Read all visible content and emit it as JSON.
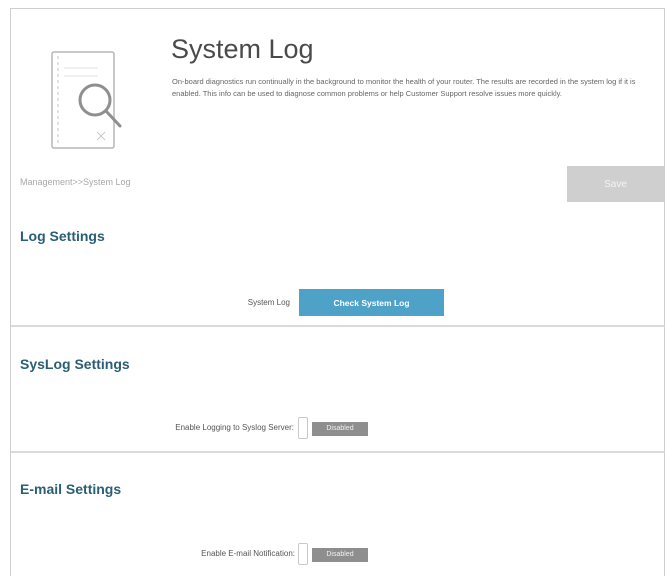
{
  "header": {
    "title": "System Log",
    "description": "On-board diagnostics run continually in the background to monitor the health of your router. The results are recorded in the system log if it is enabled. This info can be used to diagnose common problems or help Customer Support resolve issues more quickly."
  },
  "breadcrumb": "Management>>System Log",
  "save_label": "Save",
  "log_settings": {
    "title": "Log Settings",
    "system_log_label": "System Log",
    "check_button": "Check System Log"
  },
  "syslog_settings": {
    "title": "SysLog Settings",
    "enable_label": "Enable Logging to Syslog Server:",
    "enable_state": "Disabled"
  },
  "email_settings": {
    "title": "E-mail Settings",
    "enable_label": "Enable E-mail Notification:",
    "enable_state": "Disabled"
  },
  "colors": {
    "section_title": "#2a5f73",
    "accent_button": "#4fa2c7",
    "disabled_toggle": "#8e8e8e",
    "save_disabled": "#cfcfcf"
  },
  "icons": {
    "header": "document-search-icon"
  }
}
